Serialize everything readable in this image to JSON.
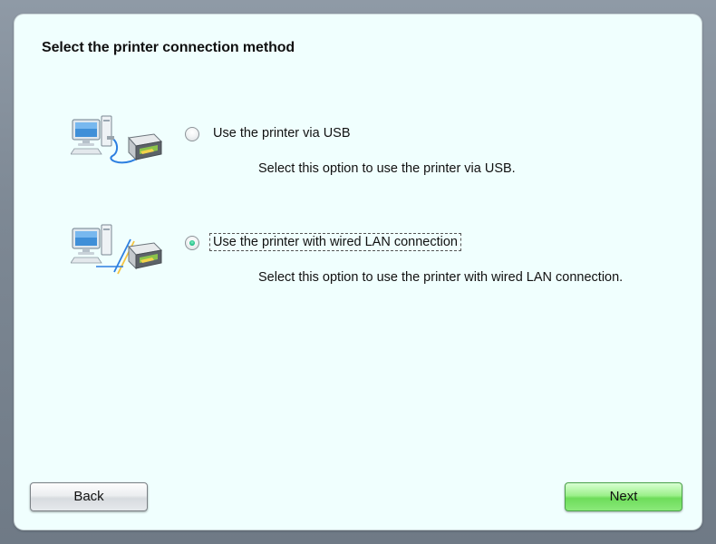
{
  "dialog": {
    "title": "Select the printer connection method"
  },
  "options": [
    {
      "label": "Use the printer via USB",
      "description": "Select this option to use the printer via USB.",
      "icon": "usb-connection-icon",
      "selected": false
    },
    {
      "label": "Use the printer with wired LAN connection",
      "description": "Select this option to use the printer with wired LAN connection.",
      "icon": "wired-lan-connection-icon",
      "selected": true
    }
  ],
  "buttons": {
    "back_label": "Back",
    "next_label": "Next"
  },
  "colors": {
    "panel_background": "#f0fffe",
    "next_button": "#7ee36a",
    "radio_selected": "#25c089"
  }
}
